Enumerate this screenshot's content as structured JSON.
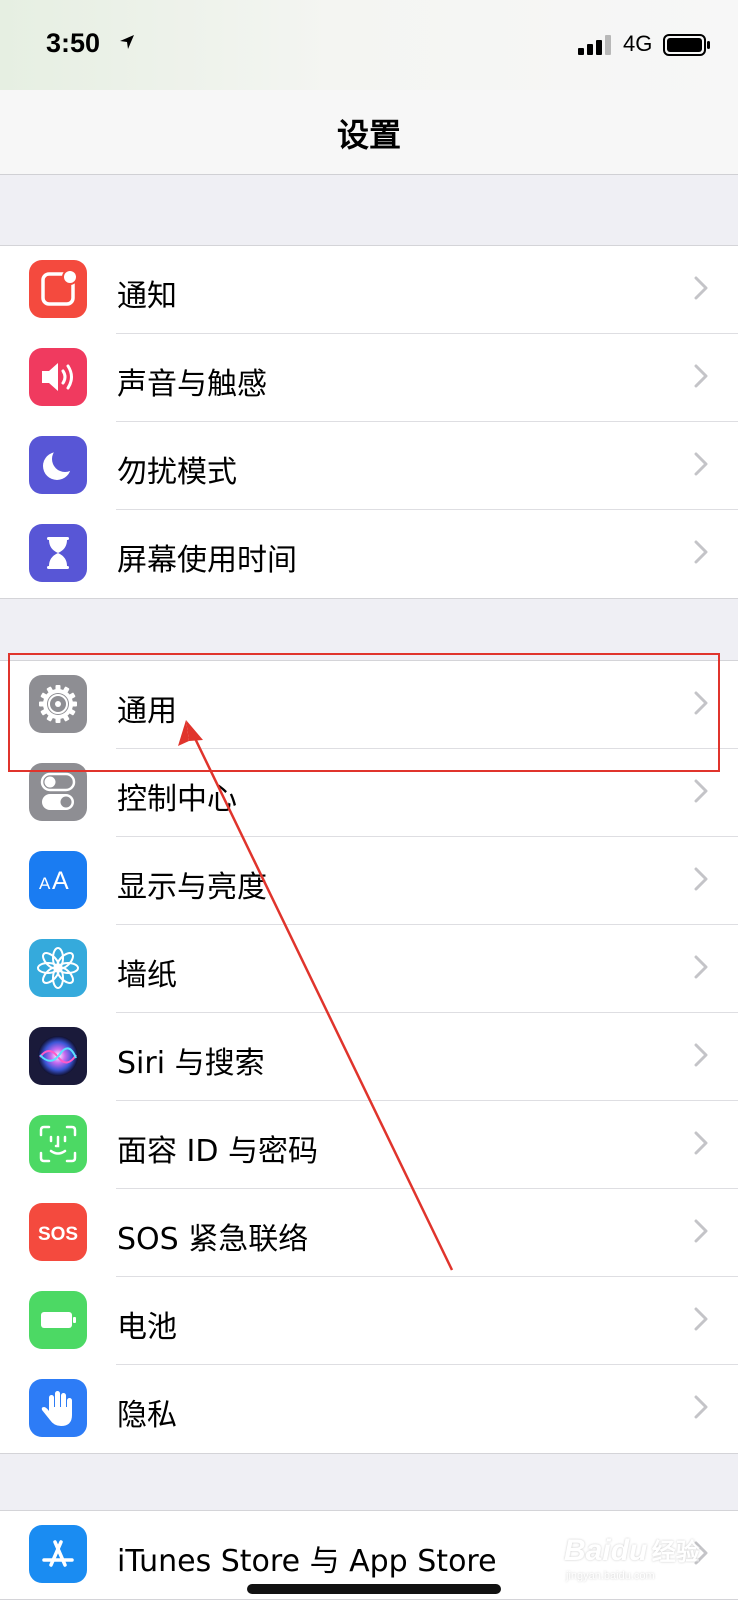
{
  "status_bar": {
    "time": "3:50",
    "network": "4G"
  },
  "nav": {
    "title": "设置"
  },
  "groups": [
    [
      {
        "label": "通知",
        "icon": "notifications-icon",
        "color": "#f44a3e"
      },
      {
        "label": "声音与触感",
        "icon": "sounds-icon",
        "color": "#f03a5f"
      },
      {
        "label": "勿扰模式",
        "icon": "moon-icon",
        "color": "#5856d6"
      },
      {
        "label": "屏幕使用时间",
        "icon": "hourglass-icon",
        "color": "#5856d6"
      }
    ],
    [
      {
        "label": "通用",
        "icon": "gear-icon",
        "color": "#8e8e93"
      },
      {
        "label": "控制中心",
        "icon": "switches-icon",
        "color": "#8e8e93"
      },
      {
        "label": "显示与亮度",
        "icon": "display-aa-icon",
        "color": "#1a7cf2"
      },
      {
        "label": "墙纸",
        "icon": "flower-icon",
        "color": "#35aadc"
      },
      {
        "label": "Siri 与搜索",
        "icon": "siri-icon",
        "color": "#1a1a3a"
      },
      {
        "label": "面容 ID 与密码",
        "icon": "face-id-icon",
        "color": "#4cd964"
      },
      {
        "label": "SOS 紧急联络",
        "icon": "sos-icon",
        "color": "#f44a3e",
        "icon_text": "SOS"
      },
      {
        "label": "电池",
        "icon": "battery-icon",
        "color": "#4cd964"
      },
      {
        "label": "隐私",
        "icon": "hand-icon",
        "color": "#2d7cf6"
      }
    ],
    [
      {
        "label": "iTunes Store 与 App Store",
        "icon": "app-store-icon",
        "color": "#1a8cf2"
      }
    ]
  ],
  "watermark": {
    "logo": "Bai",
    "logo_paw": "du",
    "text": "经验",
    "sub": "jingyan.baidu.com"
  }
}
